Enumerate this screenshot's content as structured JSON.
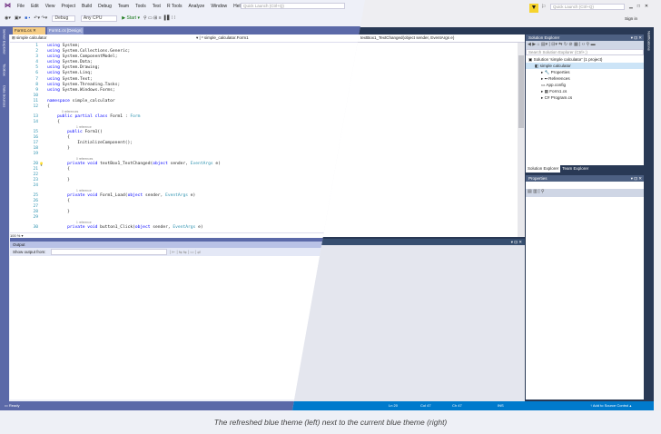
{
  "menu": [
    "File",
    "Edit",
    "View",
    "Project",
    "Build",
    "Debug",
    "Team",
    "Tools",
    "Test",
    "R Tools",
    "Analyze",
    "Window",
    "Help"
  ],
  "quick_launch_placeholder": "Quick Launch (Ctrl+Q)",
  "toolbar": {
    "config": "Debug",
    "platform": "Any CPU",
    "start": "▶ Start ▾"
  },
  "tabs": [
    {
      "label": "Form1.cs",
      "active": true
    },
    {
      "label": "Form1.cs [Design]",
      "active": false
    }
  ],
  "nav": {
    "project": "simple calculator",
    "class": "simple_calculator.Form1",
    "member": "textBox1_TextChanged(object sender, EventArgs e)"
  },
  "side_left": [
    "Server Explorer",
    "Toolbox",
    "Data Sources"
  ],
  "side_right": [
    "Notifications"
  ],
  "code": [
    {
      "n": 1,
      "t": "using System;"
    },
    {
      "n": 2,
      "t": "using System.Collections.Generic;"
    },
    {
      "n": 3,
      "t": "using System.ComponentModel;"
    },
    {
      "n": 4,
      "t": "using System.Data;"
    },
    {
      "n": 5,
      "t": "using System.Drawing;"
    },
    {
      "n": 6,
      "t": "using System.Linq;"
    },
    {
      "n": 7,
      "t": "using System.Text;"
    },
    {
      "n": 8,
      "t": "using System.Threading.Tasks;"
    },
    {
      "n": 9,
      "t": "using System.Windows.Forms;"
    },
    {
      "n": 10,
      "t": ""
    },
    {
      "n": 11,
      "t": "namespace simple_calculator"
    },
    {
      "n": 12,
      "t": "{"
    },
    {
      "lens": "0 references",
      "i": 1
    },
    {
      "n": 13,
      "t": "    public partial class Form1 : Form"
    },
    {
      "n": 14,
      "t": "    {"
    },
    {
      "lens": "1 reference",
      "i": 2
    },
    {
      "n": 15,
      "t": "        public Form1()"
    },
    {
      "n": 16,
      "t": "        {"
    },
    {
      "n": 17,
      "t": "            InitializeComponent();"
    },
    {
      "n": 18,
      "t": "        }"
    },
    {
      "n": 19,
      "t": ""
    },
    {
      "lens": "0 references",
      "i": 2
    },
    {
      "n": 20,
      "t": "        private void textBox1_TextChanged(object sender, EventArgs e)",
      "cur": true
    },
    {
      "n": 21,
      "t": "        {"
    },
    {
      "n": 22,
      "t": ""
    },
    {
      "n": 23,
      "t": "        }"
    },
    {
      "n": 24,
      "t": ""
    },
    {
      "lens": "1 reference",
      "i": 2
    },
    {
      "n": 25,
      "t": "        private void Form1_Load(object sender, EventArgs e)"
    },
    {
      "n": 26,
      "t": "        {"
    },
    {
      "n": 27,
      "t": ""
    },
    {
      "n": 28,
      "t": "        }"
    },
    {
      "n": 29,
      "t": ""
    },
    {
      "lens": "1 reference",
      "i": 2
    },
    {
      "n": 30,
      "t": "        private void button1_Click(object sender, EventArgs e)"
    }
  ],
  "zoom": "100 %",
  "output": {
    "title": "Output",
    "show_from": "Show output from:"
  },
  "status_left": "Ready",
  "status_right": {
    "ln": "Ln 20",
    "col": "Col 47",
    "ch": "Ch 47",
    "ins": "INS",
    "source": "↑ Add to Source Control ▴"
  },
  "sign_in": "Sign in",
  "solution_explorer": {
    "title": "Solution Explorer",
    "search": "Search Solution Explorer (Ctrl+;)",
    "items": [
      {
        "label": "Solution 'simple calculator' (1 project)",
        "d": 0
      },
      {
        "label": "simple calculator",
        "d": 1,
        "sel": true
      },
      {
        "label": "Properties",
        "d": 2
      },
      {
        "label": "References",
        "d": 2
      },
      {
        "label": "App.config",
        "d": 2
      },
      {
        "label": "Form1.cs",
        "d": 2
      },
      {
        "label": "Program.cs",
        "d": 2
      }
    ],
    "tabs": [
      "Solution Explorer",
      "Team Explorer"
    ]
  },
  "properties": {
    "title": "Properties"
  },
  "caption": "The refreshed blue theme (left) next to the current blue theme (right)"
}
